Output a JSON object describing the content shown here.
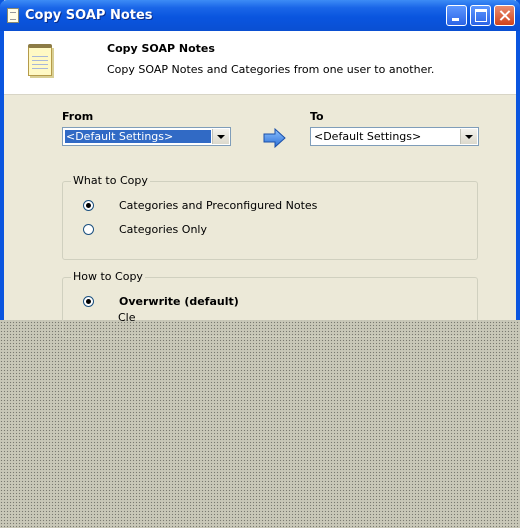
{
  "window": {
    "title": "Copy SOAP Notes",
    "caption_buttons": [
      "minimize",
      "maximize",
      "close"
    ]
  },
  "header": {
    "title": "Copy SOAP Notes",
    "description": "Copy SOAP Notes and Categories from one user to another.",
    "icon": "notepad-icon"
  },
  "from": {
    "label": "From",
    "value": "<Default Settings>"
  },
  "to": {
    "label": "To",
    "value": "<Default Settings>"
  },
  "what_to_copy": {
    "legend": "What to Copy",
    "options": [
      {
        "label": "Categories and Preconfigured Notes",
        "checked": true
      },
      {
        "label": "Categories Only",
        "checked": false
      }
    ]
  },
  "how_to_copy": {
    "legend": "How to Copy",
    "options": [
      {
        "label": "Overwrite (default)",
        "checked": true
      }
    ],
    "partial_text": "Cle"
  },
  "colors": {
    "titlebar": "#0a55df",
    "dialog_bg": "#ece9d8",
    "selection": "#316ac5"
  }
}
